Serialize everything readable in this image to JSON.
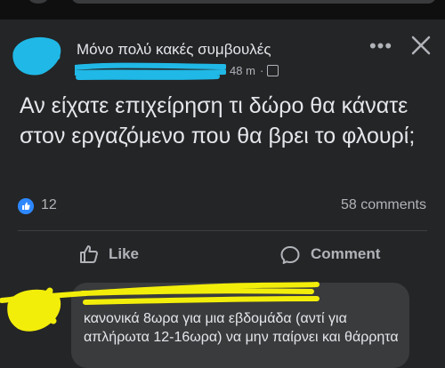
{
  "post": {
    "group_name": "Μόνο πολύ κακές συμβουλές",
    "time": "48 m",
    "meta_separator": "·",
    "text": "Αν είχατε επιχείρηση τι δώρο θα κάνατε στον εργαζόμενο που θα βρει το φλουρί;",
    "reaction_count": "12",
    "comments_count": "58 comments"
  },
  "actions": {
    "like_label": "Like",
    "comment_label": "Comment",
    "more_symbol": "•••"
  },
  "comment": {
    "text": "κανονικά 8ωρα για μια εβδομάδα (αντί για απλήρωτα 12-16ωρα) να μην παίρνει και θάρρητα"
  },
  "colors": {
    "background": "#18191a",
    "card": "#242526",
    "bubble": "#3a3b3c",
    "text_primary": "#e4e6eb",
    "text_secondary": "#b0b3b8",
    "like_blue": "#2d88ff",
    "redaction_cyan": "#20b8e6",
    "redaction_yellow": "#f2ee0a"
  },
  "icons": [
    "more-icon",
    "close-icon",
    "globe-icon",
    "like-icon",
    "thumbs-up-outline-icon",
    "comment-bubble-icon"
  ]
}
